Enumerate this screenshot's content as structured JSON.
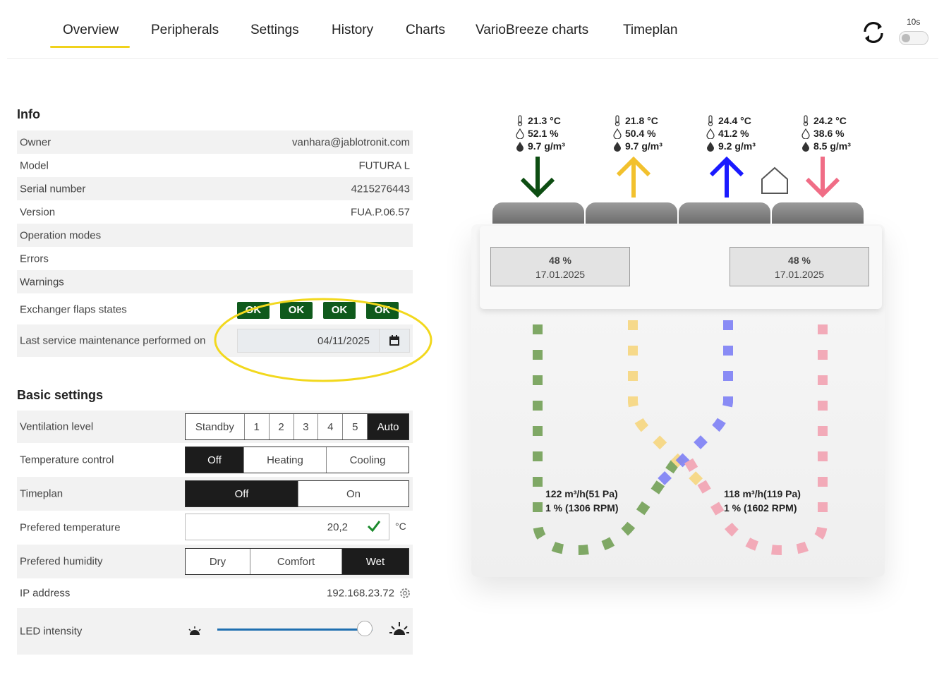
{
  "nav": {
    "tabs": [
      {
        "label": "Overview",
        "active": true
      },
      {
        "label": "Peripherals"
      },
      {
        "label": "Settings"
      },
      {
        "label": "History"
      },
      {
        "label": "Charts"
      },
      {
        "label": "VarioBreeze charts"
      },
      {
        "label": "Timeplan"
      }
    ],
    "refresh_interval": "10s",
    "auto_refresh_on": false
  },
  "info": {
    "title": "Info",
    "rows": [
      {
        "label": "Owner",
        "value": "vanhara@jablotronit.com"
      },
      {
        "label": "Model",
        "value": "FUTURA L"
      },
      {
        "label": "Serial number",
        "value": "4215276443"
      },
      {
        "label": "Version",
        "value": "FUA.P.06.57"
      },
      {
        "label": "Operation modes",
        "value": ""
      },
      {
        "label": "Errors",
        "value": ""
      },
      {
        "label": "Warnings",
        "value": ""
      }
    ],
    "flaps": {
      "label": "Exchanger flaps states",
      "states": [
        "OK",
        "OK",
        "OK",
        "OK"
      ]
    },
    "service": {
      "label": "Last service maintenance performed on",
      "value": "04/11/2025"
    }
  },
  "basic": {
    "title": "Basic settings",
    "ventilation": {
      "label": "Ventilation level",
      "options": [
        "Standby",
        "1",
        "2",
        "3",
        "4",
        "5",
        "Auto"
      ],
      "selected": "Auto"
    },
    "temperature_control": {
      "label": "Temperature control",
      "options": [
        "Off",
        "Heating",
        "Cooling"
      ],
      "selected": "Off"
    },
    "timeplan": {
      "label": "Timeplan",
      "options": [
        "Off",
        "On"
      ],
      "selected": "Off"
    },
    "preferred_temperature": {
      "label": "Prefered temperature",
      "value": "20,2",
      "unit": "°C"
    },
    "preferred_humidity": {
      "label": "Prefered humidity",
      "options": [
        "Dry",
        "Comfort",
        "Wet"
      ],
      "selected": "Wet"
    },
    "ip": {
      "label": "IP address",
      "value": "192.168.23.72"
    },
    "led": {
      "label": "LED intensity",
      "level": 0.95
    }
  },
  "diagram": {
    "sensors": [
      {
        "temp": "21.3 °C",
        "humidity": "52.1 %",
        "abs": "9.7 g/m³",
        "color": "#0d4d12",
        "direction": "down"
      },
      {
        "temp": "21.8 °C",
        "humidity": "50.4 %",
        "abs": "9.7 g/m³",
        "color": "#f2c12e",
        "direction": "up"
      },
      {
        "temp": "24.4 °C",
        "humidity": "41.2 %",
        "abs": "9.2 g/m³",
        "color": "#1a1aff",
        "direction": "up"
      },
      {
        "temp": "24.2 °C",
        "humidity": "38.6 %",
        "abs": "8.5 g/m³",
        "color": "#f06d86",
        "direction": "down"
      }
    ],
    "filters": [
      {
        "percent": "48 %",
        "date": "17.01.2025"
      },
      {
        "percent": "48 %",
        "date": "17.01.2025"
      }
    ],
    "flows": [
      {
        "line1": "122 m³/h(51 Pa)",
        "line2": "1 % (1306 RPM)"
      },
      {
        "line1": "118 m³/h(119 Pa)",
        "line2": "1 % (1602 RPM)"
      }
    ],
    "colors": {
      "green": "#7fa865",
      "yellow": "#f6d98a",
      "blue": "#7d80f5",
      "pink": "#f2aab8"
    }
  }
}
